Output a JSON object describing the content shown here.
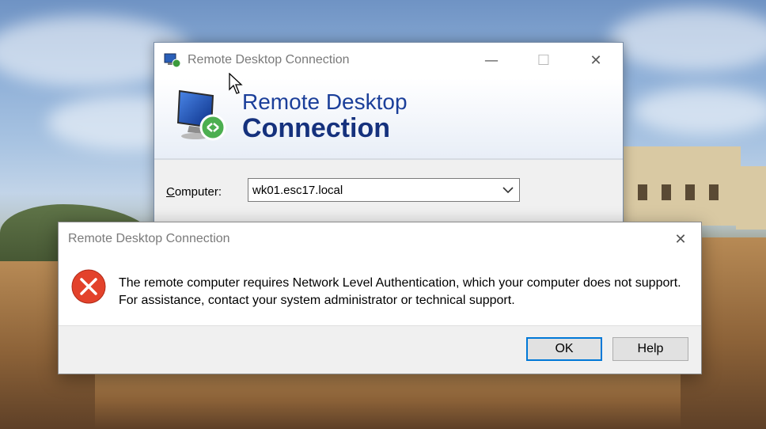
{
  "rdc_window": {
    "title": "Remote Desktop Connection",
    "banner_line1": "Remote Desktop",
    "banner_line2": "Connection",
    "computer_label_key": "C",
    "computer_label_rest": "omputer:",
    "computer_value": "wk01.esc17.local",
    "controls": {
      "minimize": "—",
      "maximize": "☐",
      "close": "✕"
    }
  },
  "error_dialog": {
    "title": "Remote Desktop Connection",
    "message": "The remote computer requires Network Level Authentication, which your computer does not support. For assistance, contact your system administrator or technical support.",
    "ok_label": "OK",
    "help_label": "Help",
    "close_glyph": "✕",
    "icon": "error-icon"
  },
  "colors": {
    "banner_blue": "#15317d",
    "error_red": "#e3422b",
    "focus_blue": "#0078d7"
  }
}
